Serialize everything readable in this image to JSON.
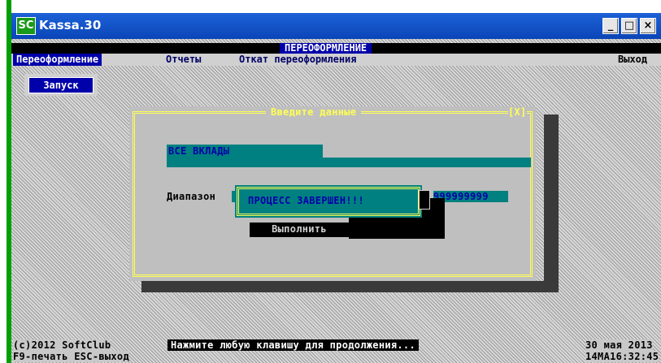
{
  "window": {
    "logo": "SC",
    "title": "Kassa.30",
    "minimize": "_",
    "maximize": "□",
    "close": "×"
  },
  "header": {
    "caption": "ПЕРЕОФОРМЛЕНИЕ"
  },
  "menu": {
    "items": [
      "Переоформление",
      "Отчеты",
      "Откат переоформления"
    ],
    "exit": "Выход"
  },
  "run_button": "Запуск",
  "dialog": {
    "title": "Введите данные",
    "close": "[X]",
    "field": "ВСЕ ВКЛАДЫ",
    "range_label": "Диапазон",
    "range_to": "999999999",
    "execute": "Выполнить"
  },
  "message": {
    "text": "ПРОЦЕСС ЗАВЕРШЕН!!!"
  },
  "status": {
    "copyright": "(c)2012 SoftClub",
    "prompt": "Нажмите любую клавишу для продолжения...",
    "date": "30 мая 2013",
    "hotkeys": "F9-печать ESC-выход",
    "time": "14MA16:32:45"
  },
  "colors": {
    "dos_blue": "#0000aa",
    "teal": "#008080",
    "frame_yellow": "#ffff55",
    "menu_gray": "#d0d0d0"
  }
}
